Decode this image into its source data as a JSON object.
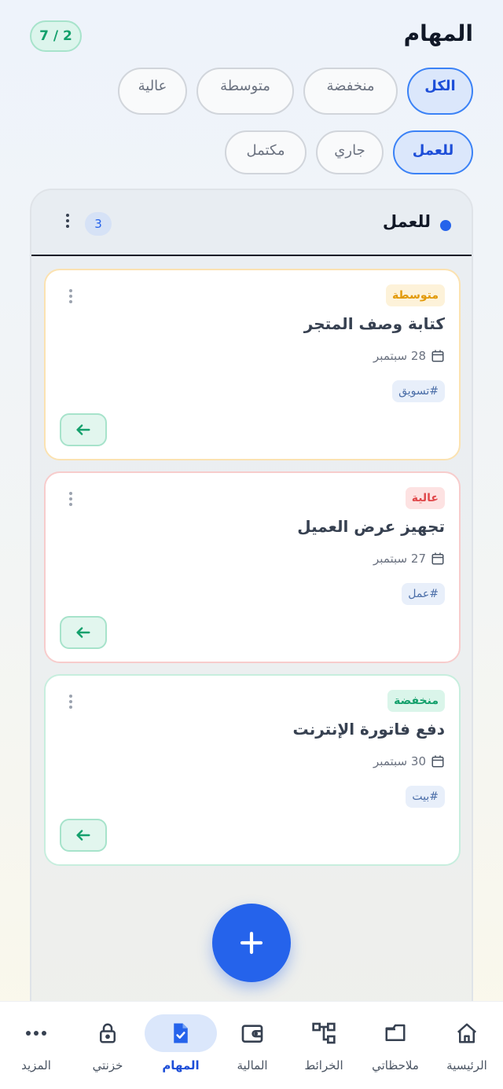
{
  "header": {
    "title": "المهام",
    "counter": "7 / 2"
  },
  "priority_filters": [
    {
      "label": "الكل",
      "active": true
    },
    {
      "label": "منخفضة",
      "active": false
    },
    {
      "label": "متوسطة",
      "active": false
    },
    {
      "label": "عالية",
      "active": false
    }
  ],
  "status_filters": [
    {
      "label": "للعمل",
      "active": true
    },
    {
      "label": "جاري",
      "active": false
    },
    {
      "label": "مكتمل",
      "active": false
    }
  ],
  "column": {
    "title": "للعمل",
    "count": "3",
    "dot_color": "#2563eb"
  },
  "tasks": [
    {
      "priority": "متوسطة",
      "title": "كتابة وصف المتجر",
      "due": "28 سبتمبر",
      "tag": "#تسويق"
    },
    {
      "priority": "عالية",
      "title": "تجهيز عرض العميل",
      "due": "27 سبتمبر",
      "tag": "#عمل"
    },
    {
      "priority": "منخفضة",
      "title": "دفع فاتورة الإنترنت",
      "due": "30 سبتمبر",
      "tag": "#بيت"
    }
  ],
  "nav": [
    {
      "label": "الرئيسية",
      "icon": "home-icon"
    },
    {
      "label": "ملاحظاتي",
      "icon": "folder-icon"
    },
    {
      "label": "الخرائط",
      "icon": "mindmap-icon"
    },
    {
      "label": "المالية",
      "icon": "wallet-icon"
    },
    {
      "label": "المهام",
      "icon": "task-icon",
      "active": true
    },
    {
      "label": "خزنتي",
      "icon": "lock-icon"
    },
    {
      "label": "المزيد",
      "icon": "more-icon"
    }
  ],
  "colors": {
    "accent": "#2563eb",
    "success": "#14a06c",
    "warning": "#e29a0b",
    "danger": "#e0484b"
  }
}
